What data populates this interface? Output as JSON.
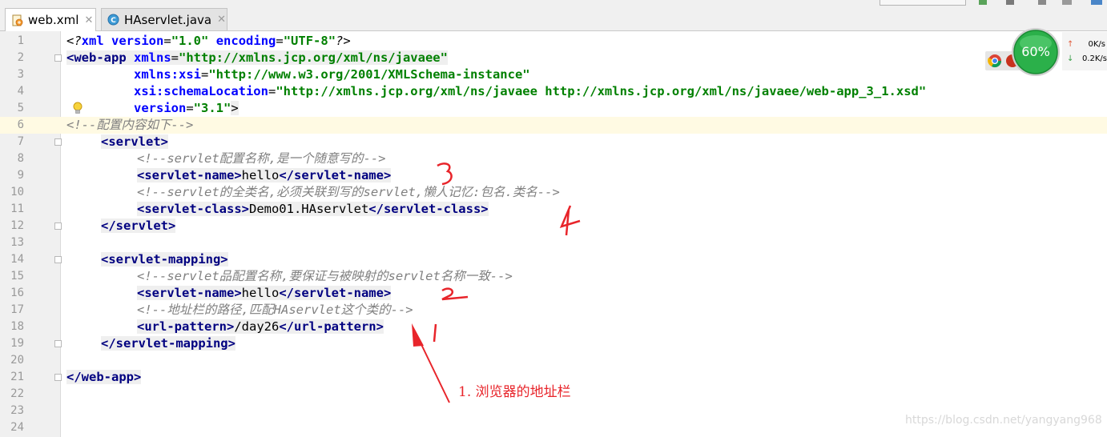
{
  "tabs": [
    {
      "label": "web.xml",
      "icon": "xml-file-icon",
      "active": true
    },
    {
      "label": "HAservlet.java",
      "icon": "java-class-icon",
      "active": false
    }
  ],
  "line_numbers": [
    "1",
    "2",
    "3",
    "4",
    "5",
    "6",
    "7",
    "8",
    "9",
    "10",
    "11",
    "12",
    "13",
    "14",
    "15",
    "16",
    "17",
    "18",
    "19",
    "20",
    "21",
    "22",
    "23",
    "24"
  ],
  "code": {
    "l1": {
      "lt": "<?",
      "xml": "xml",
      "sp1": " ",
      "a1": "version",
      "eq1": "=",
      "v1": "\"1.0\"",
      "sp2": " ",
      "a2": "encoding",
      "eq2": "=",
      "v2": "\"UTF-8\"",
      "end": "?>"
    },
    "l2": {
      "open": "<web-app",
      "sp": " ",
      "a": "xmlns",
      "eq": "=",
      "v": "\"http://xmlns.jcp.org/xml/ns/javaee\""
    },
    "l3": {
      "ind": "         ",
      "a": "xmlns:xsi",
      "eq": "=",
      "v": "\"http://www.w3.org/2001/XMLSchema-instance\""
    },
    "l4": {
      "ind": "         ",
      "a": "xsi:schemaLocation",
      "eq": "=",
      "v": "\"http://xmlns.jcp.org/xml/ns/javaee http://xmlns.jcp.org/xml/ns/javaee/web-app_3_1.xsd\""
    },
    "l5": {
      "ind": "         ",
      "a": "version",
      "eq": "=",
      "v": "\"3.1\"",
      "end": ">"
    },
    "l6": "<!--配置内容如下-->",
    "l7": "<servlet>",
    "l8": "<!--servlet配置名称,是一个随意写的-->",
    "l9": {
      "o": "<servlet-name>",
      "t": "hello",
      "c": "</servlet-name>"
    },
    "l10": "<!--servlet的全类名,必须关联到写的servlet,懒人记忆:包名.类名-->",
    "l11": {
      "o": "<servlet-class>",
      "t": "Demo01.HAservlet",
      "c": "</servlet-class>"
    },
    "l12": "</servlet>",
    "l14": "<servlet-mapping>",
    "l15": "<!--servlet品配置名称,要保证与被映射的servlet名称一致-->",
    "l16": {
      "o": "<servlet-name>",
      "t": "hello",
      "c": "</servlet-name>"
    },
    "l17": "<!--地址栏的路径,匹配HAservlet这个类的-->",
    "l18": {
      "o": "<url-pattern>",
      "t": "/day26",
      "c": "</url-pattern>"
    },
    "l19": "</servlet-mapping>",
    "l21": "</web-app>"
  },
  "net_widget": {
    "percent": "60%",
    "upload": "0K/s",
    "download": "0.2K/s"
  },
  "annotations": {
    "n1": "1",
    "n2": "2",
    "n3": "3",
    "n4": "4",
    "arrow_label": "1. 浏览器的地址栏"
  },
  "watermark": "https://blog.csdn.net/yangyang968",
  "colors": {
    "tag": "#000080",
    "attribute": "#0000ff",
    "value": "#008000",
    "comment": "#808080",
    "annotation": "#e8252b",
    "current_line": "#fffae3"
  }
}
